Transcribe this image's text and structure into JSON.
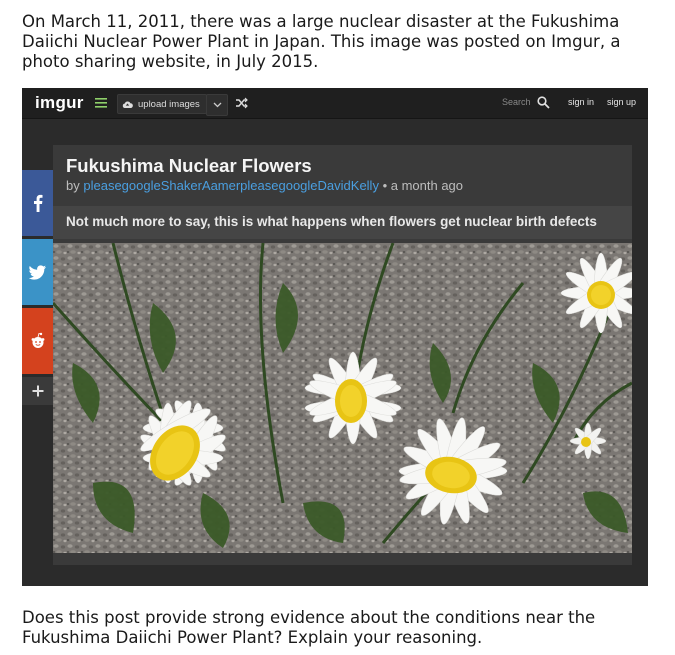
{
  "intro_text": "On March 11, 2011, there was a large nuclear disaster at the Fukushima Daiichi Nuclear Power Plant in Japan. This image was posted on Imgur, a photo sharing website, in July 2015.",
  "question_text": "Does this post provide strong evidence about the conditions near the Fukushima Daiichi Power Plant? Explain your reasoning.",
  "imgur": {
    "logo": "imgur",
    "upload_label": "upload images",
    "search_label": "Search",
    "signin_label": "sign in",
    "signup_label": "sign up",
    "post": {
      "title": "Fukushima Nuclear Flowers",
      "by_prefix": "by",
      "author": "pleasegoogleShakerAamerpleasegoogleDavidKelly",
      "time": "• a month ago",
      "description": "Not much more to say, this is what happens when flowers get nuclear birth defects"
    },
    "share": [
      "facebook-icon",
      "twitter-icon",
      "reddit-icon",
      "plus-icon"
    ]
  },
  "colors": {
    "facebook": "#3b5998",
    "twitter": "#3b93c7",
    "reddit": "#d4421e",
    "link": "#4a9fe0"
  }
}
